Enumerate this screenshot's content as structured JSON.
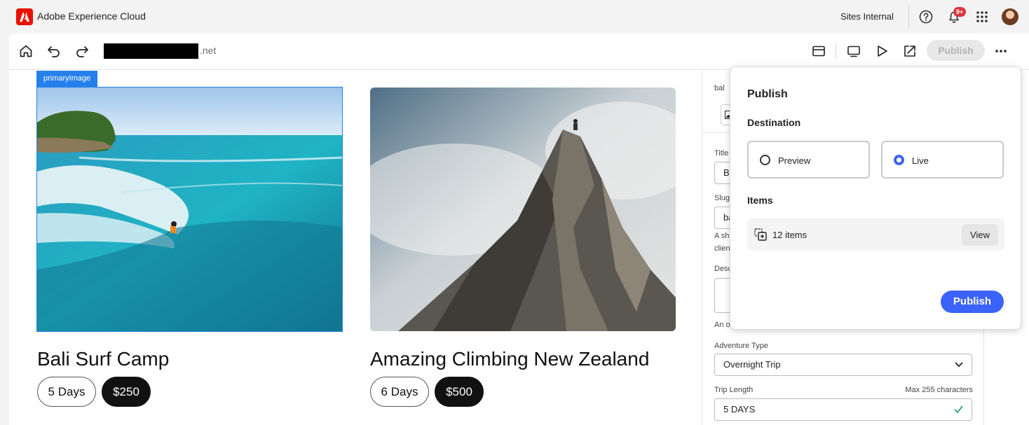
{
  "shell": {
    "app_title": "Adobe Experience Cloud",
    "org_name": "Sites Internal",
    "notification_count": "9+",
    "icons": [
      "adobe-logo",
      "help-icon",
      "bell-icon",
      "apps-grid-icon",
      "avatar"
    ]
  },
  "toolbar": {
    "domain_suffix": ".net",
    "publish_label": "Publish",
    "icons": [
      "home-icon",
      "undo-icon",
      "redo-icon",
      "properties-panel-icon",
      "desktop-preview-icon",
      "play-icon",
      "open-external-icon",
      "more-icon"
    ]
  },
  "canvas": {
    "selected_label": "primaryImage",
    "cards": [
      {
        "title": "Bali Surf Camp",
        "duration": "5 Days",
        "price": "$250"
      },
      {
        "title": "Amazing Climbing New Zealand",
        "duration": "6 Days",
        "price": "$500"
      }
    ]
  },
  "properties": {
    "header_fragment": "bal",
    "title_label": "Title",
    "title_value": "Ba",
    "slug_label": "Slug",
    "slug_value": "ba",
    "slug_help_1": "A sh",
    "slug_help_2": "clien",
    "description_label": "Desc",
    "description_help": "An o",
    "adventure_type_label": "Adventure Type",
    "adventure_type_value": "Overnight Trip",
    "trip_length_label": "Trip Length",
    "trip_length_counter": "Max 255 characters",
    "trip_length_value": "5 DAYS"
  },
  "publish_popover": {
    "title": "Publish",
    "destination_label": "Destination",
    "options": [
      {
        "label": "Preview",
        "selected": false
      },
      {
        "label": "Live",
        "selected": true
      }
    ],
    "items_label": "Items",
    "items_count": "12 items",
    "view_label": "View",
    "publish_label": "Publish",
    "accent_color": "#3b63fb"
  },
  "colors": {
    "brand_red": "#eb1000",
    "selection_blue": "#2680eb",
    "badge_red": "#d7373f"
  }
}
